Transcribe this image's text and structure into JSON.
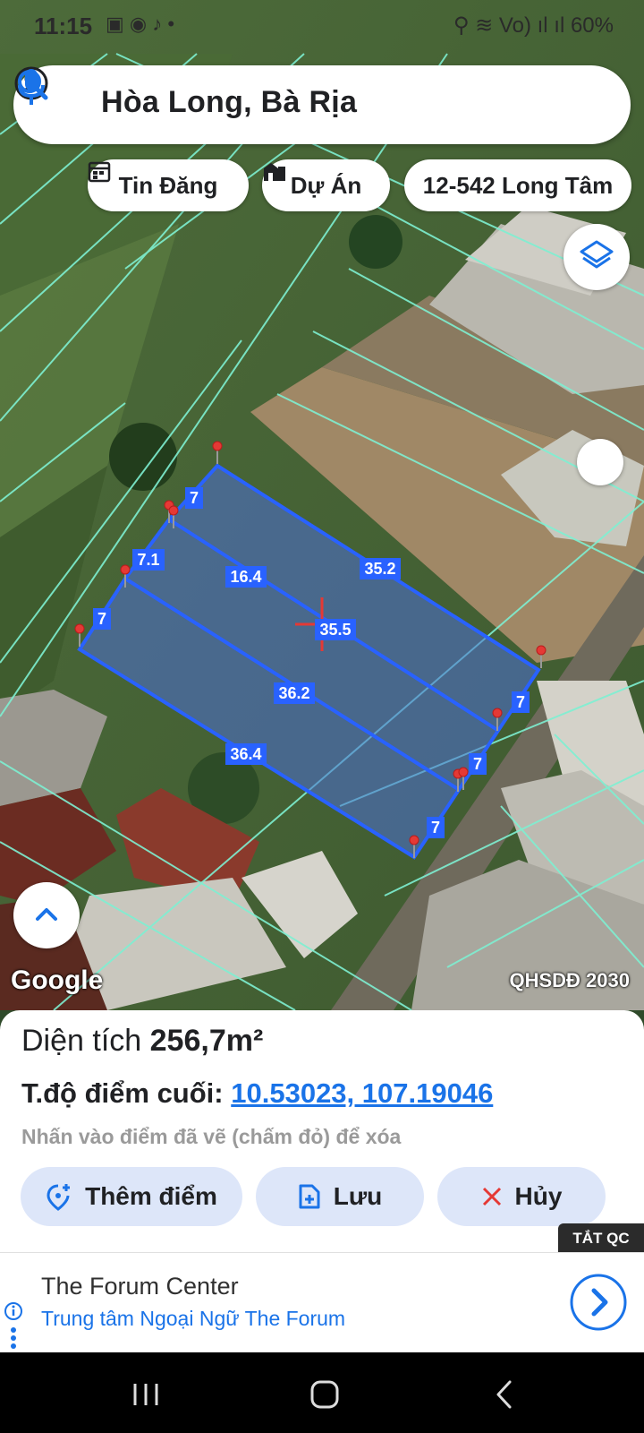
{
  "status_bar": {
    "time": "11:15",
    "notif_icons": "▣ ◉ ♪ •",
    "right_text": "⚲ ≋ Vo) ıl ıl 60%"
  },
  "search": {
    "title": "Hòa Long, Bà Rịa"
  },
  "chips": [
    {
      "label": "Tin Đăng",
      "icon": "calendar-icon"
    },
    {
      "label": "Dự Án",
      "icon": "buildings-icon"
    },
    {
      "label": "12-542 Long Tâm"
    }
  ],
  "map": {
    "watermark_logo": "Google",
    "layer_label": "QHSDĐ 2030",
    "segment_labels": [
      "7",
      "7.1",
      "7",
      "16.4",
      "35.2",
      "35.5",
      "36.2",
      "36.4",
      "7",
      "7",
      "7"
    ],
    "colors": {
      "parcel_fill": "#4d6fd6",
      "parcel_stroke": "#2962ff",
      "lot_lines": "#7ef0d2",
      "marker": "#e53935"
    }
  },
  "panel": {
    "area_label": "Diện tích",
    "area_value": "256,7m²",
    "coord_label": "T.độ điểm cuối:",
    "coord_value": "10.53023, 107.19046",
    "hint": "Nhấn vào điểm đã vẽ (chấm đỏ) để xóa",
    "buttons": [
      {
        "label": "Thêm điểm",
        "icon": "add-location-icon"
      },
      {
        "label": "Lưu",
        "icon": "save-file-icon"
      },
      {
        "label": "Hủy",
        "icon": "close-icon"
      }
    ]
  },
  "ad": {
    "tat_qc": "TẮT QC",
    "title": "The Forum Center",
    "subtitle": "Trung tâm Ngoại Ngữ The Forum"
  }
}
